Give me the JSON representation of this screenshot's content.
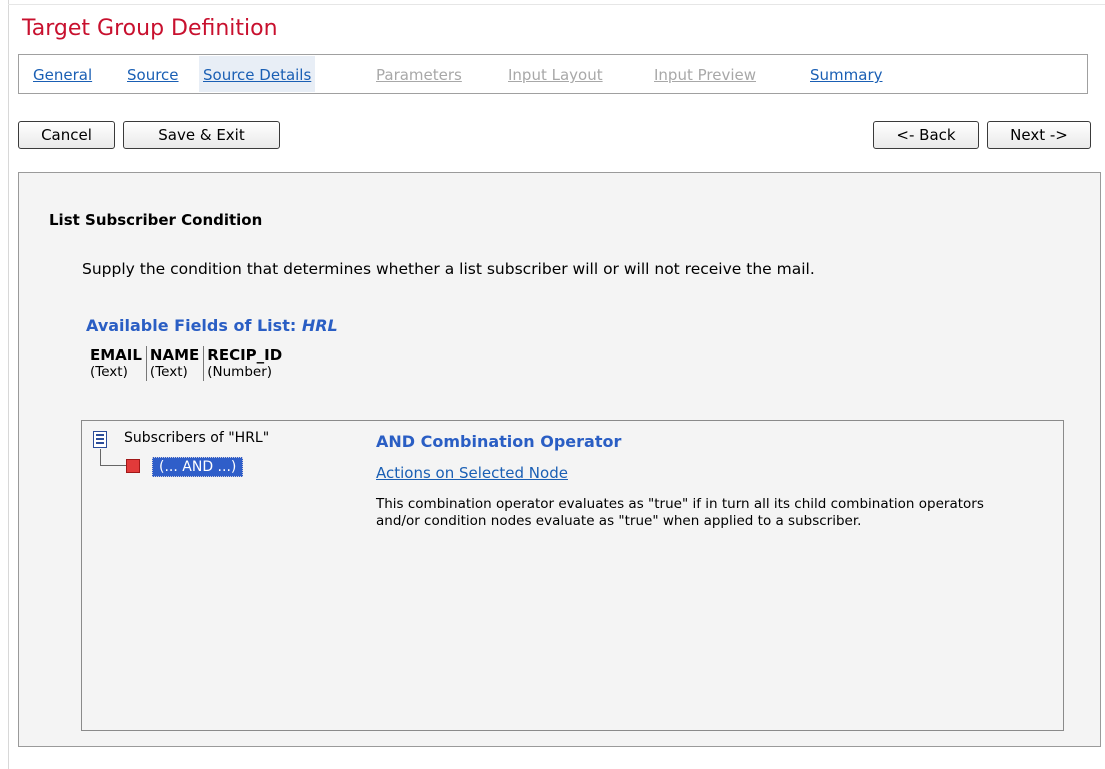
{
  "page": {
    "title": "Target Group Definition"
  },
  "tabs": [
    {
      "label": "General",
      "state": "link"
    },
    {
      "label": "Source",
      "state": "link"
    },
    {
      "label": "Source Details",
      "state": "active"
    },
    {
      "label": "Parameters",
      "state": "disabled"
    },
    {
      "label": "Input Layout",
      "state": "disabled"
    },
    {
      "label": "Input Preview",
      "state": "disabled"
    },
    {
      "label": "Summary",
      "state": "link"
    }
  ],
  "toolbar": {
    "cancel_label": "Cancel",
    "save_exit_label": "Save & Exit",
    "back_label": "<- Back",
    "next_label": "Next ->"
  },
  "section": {
    "title": "List Subscriber Condition",
    "description": "Supply the condition that determines whether a list subscriber will or will not receive the mail."
  },
  "fields": {
    "heading_prefix": "Available Fields of List: ",
    "list_name": "HRL",
    "columns": [
      {
        "name": "EMAIL",
        "type": "(Text)"
      },
      {
        "name": "NAME",
        "type": "(Text)"
      },
      {
        "name": "RECIP_ID",
        "type": "(Number)"
      }
    ]
  },
  "tree": {
    "root_label": "Subscribers of \"HRL\"",
    "selected_node_label": "(... AND ...)",
    "root_icon": "document-list-icon",
    "node_icon": "red-square-node-icon"
  },
  "node_details": {
    "title": "AND Combination Operator",
    "actions_link": "Actions on Selected Node",
    "description": "This combination operator evaluates as \"true\" if in turn all its child combination operators and/or condition nodes evaluate as \"true\" when applied to a subscriber."
  },
  "colors": {
    "title_red": "#c8102e",
    "link_blue": "#1a5fb4",
    "heading_blue": "#2a5ec4",
    "selection_blue": "#2f5ec9",
    "disabled_gray": "#a8a8a8"
  }
}
